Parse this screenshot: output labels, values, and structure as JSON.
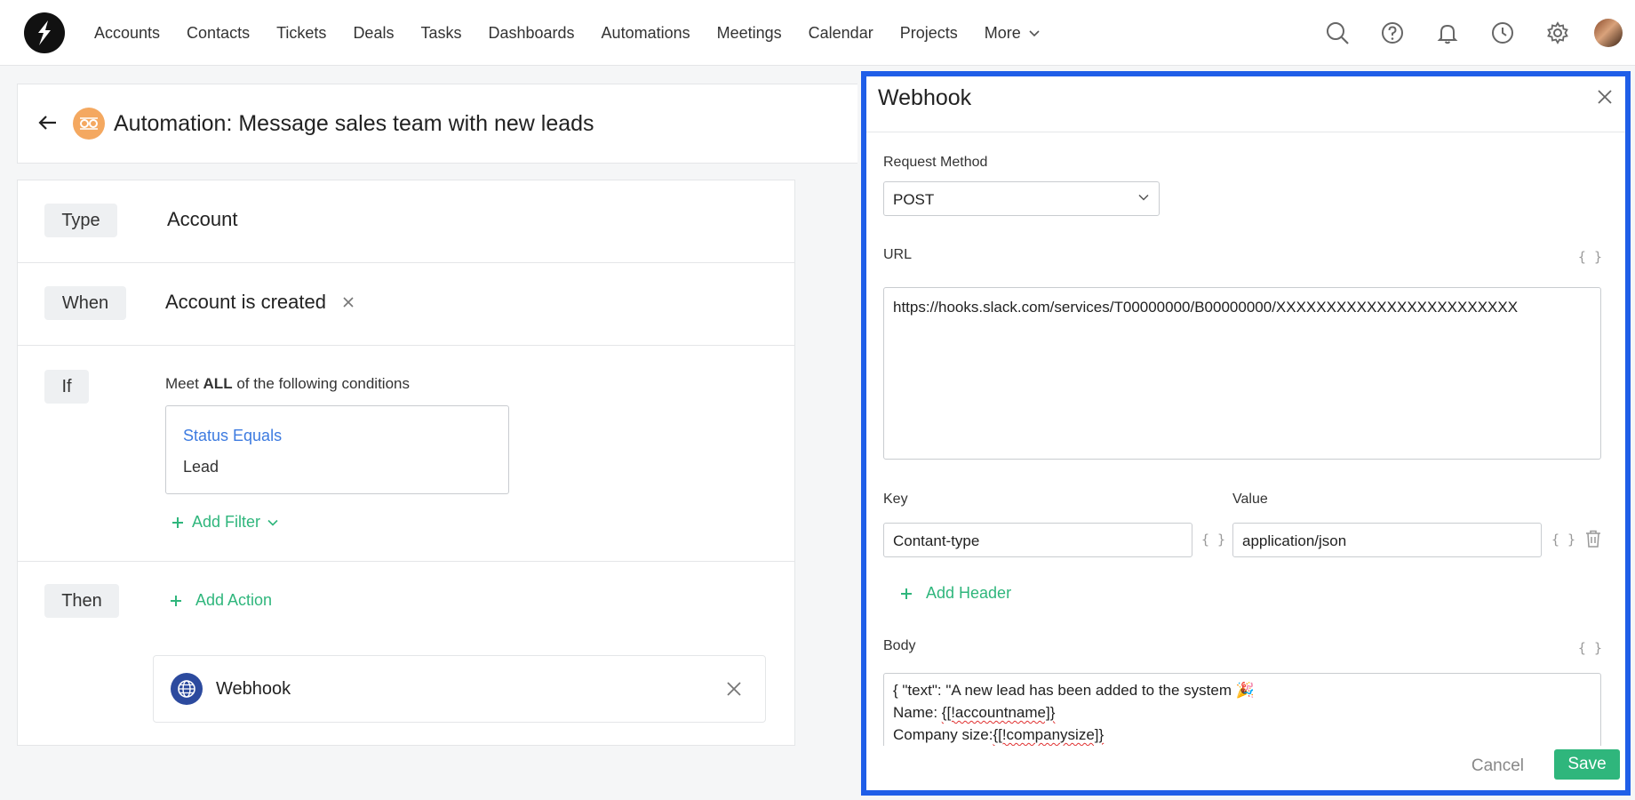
{
  "nav": {
    "items": [
      "Accounts",
      "Contacts",
      "Tickets",
      "Deals",
      "Tasks",
      "Dashboards",
      "Automations",
      "Meetings",
      "Calendar",
      "Projects"
    ],
    "more_label": "More",
    "icons": [
      "search-icon",
      "help-icon",
      "bell-icon",
      "clock-icon",
      "gear-icon"
    ]
  },
  "header": {
    "title": "Automation: Message sales team with new leads"
  },
  "rules": {
    "type_tag": "Type",
    "type_value": "Account",
    "when_tag": "When",
    "when_value": "Account is created",
    "if_tag": "If",
    "if_prefix": "Meet",
    "if_bold": "ALL",
    "if_suffix": "of the following conditions",
    "condition_field": "Status Equals",
    "condition_value": "Lead",
    "add_filter": "Add Filter",
    "then_tag": "Then",
    "add_action": "Add Action",
    "action_name": "Webhook"
  },
  "panel": {
    "title": "Webhook",
    "request_method_label": "Request Method",
    "request_method_value": "POST",
    "url_label": "URL",
    "url_value": "https://hooks.slack.com/services/T00000000/B00000000/XXXXXXXXXXXXXXXXXXXXXXXX",
    "braces": "{ }",
    "key_label": "Key",
    "value_label": "Value",
    "header_key": "Contant-type",
    "header_value": "application/json",
    "add_header": "Add Header",
    "body_label": "Body",
    "body_line1": "{ \"text\": \"A new lead has been added to the system ",
    "body_emoji": "🎉",
    "body_line2_prefix": "Name: ",
    "body_line2_token": "{[!accountname]}",
    "body_line3_prefix": "Company size:",
    "body_line3_token": "{[!companysize]}",
    "cancel": "Cancel",
    "save": "Save"
  },
  "colors": {
    "accent_green": "#2fb67c",
    "link_blue": "#3d7be0",
    "panel_border": "#1f5ee8",
    "badge_orange": "#f4a860",
    "webhook_icon": "#2c4a9e"
  }
}
